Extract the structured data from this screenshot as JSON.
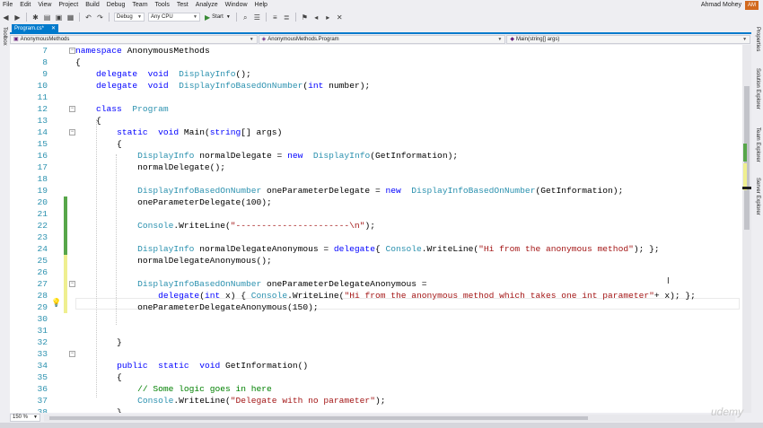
{
  "menu": [
    "File",
    "Edit",
    "View",
    "Project",
    "Build",
    "Debug",
    "Team",
    "Tools",
    "Test",
    "Analyze",
    "Window",
    "Help"
  ],
  "user": {
    "name": "Ahmad Mohey",
    "initials": "AM"
  },
  "toolbar": {
    "config": "Debug",
    "platform": "Any CPU",
    "start_label": "Start"
  },
  "side": {
    "left": "Toolbox",
    "right": [
      "Properties",
      "Solution Explorer",
      "Team Explorer",
      "Server Explorer"
    ]
  },
  "tab": {
    "name": "Program.cs*"
  },
  "nav": {
    "project": "AnonymousMethods",
    "class": "AnonymousMethods.Program",
    "member": "Main(string[] args)"
  },
  "zoom": "150 %",
  "code": [
    {
      "n": "7",
      "t": [
        [
          "kw",
          "namespace"
        ],
        [
          "",
          "AnonymousMethods"
        ]
      ]
    },
    {
      "n": "8",
      "t": [
        [
          "",
          "{"
        ]
      ]
    },
    {
      "n": "9",
      "t": [
        [
          "",
          "    "
        ],
        [
          "kw",
          "delegate"
        ],
        [
          "",
          ""
        ],
        [
          "kw",
          "void"
        ],
        [
          "",
          ""
        ],
        [
          "ty",
          "DisplayInfo"
        ],
        [
          "",
          "();"
        ]
      ]
    },
    {
      "n": "10",
      "t": [
        [
          "",
          "    "
        ],
        [
          "kw",
          "delegate"
        ],
        [
          "",
          ""
        ],
        [
          "kw",
          "void"
        ],
        [
          "",
          ""
        ],
        [
          "ty",
          "DisplayInfoBasedOnNumber"
        ],
        [
          "",
          "("
        ],
        [
          "kw",
          "int"
        ],
        [
          "",
          "number);"
        ]
      ]
    },
    {
      "n": "11",
      "t": []
    },
    {
      "n": "12",
      "t": [
        [
          "",
          "    "
        ],
        [
          "kw",
          "class"
        ],
        [
          "",
          ""
        ],
        [
          "ty",
          "Program"
        ]
      ]
    },
    {
      "n": "13",
      "t": [
        [
          "",
          "    {"
        ]
      ]
    },
    {
      "n": "14",
      "t": [
        [
          "",
          "        "
        ],
        [
          "kw",
          "static"
        ],
        [
          "",
          ""
        ],
        [
          "kw",
          "void"
        ],
        [
          "",
          "Main("
        ],
        [
          "kw",
          "string"
        ],
        [
          "",
          "[] args)"
        ]
      ]
    },
    {
      "n": "15",
      "t": [
        [
          "",
          "        {"
        ]
      ]
    },
    {
      "n": "16",
      "t": [
        [
          "",
          "            "
        ],
        [
          "ty",
          "DisplayInfo"
        ],
        [
          "",
          "normalDelegate = "
        ],
        [
          "kw",
          "new"
        ],
        [
          "",
          ""
        ],
        [
          "ty",
          "DisplayInfo"
        ],
        [
          "",
          "(GetInformation);"
        ]
      ]
    },
    {
      "n": "17",
      "t": [
        [
          "",
          "            normalDelegate();"
        ]
      ]
    },
    {
      "n": "18",
      "t": []
    },
    {
      "n": "19",
      "t": [
        [
          "",
          "            "
        ],
        [
          "ty",
          "DisplayInfoBasedOnNumber"
        ],
        [
          "",
          "oneParameterDelegate = "
        ],
        [
          "kw",
          "new"
        ],
        [
          "",
          ""
        ],
        [
          "ty",
          "DisplayInfoBasedOnNumber"
        ],
        [
          "",
          "(GetInformation);"
        ]
      ]
    },
    {
      "n": "20",
      "t": [
        [
          "",
          "            oneParameterDelegate(100);"
        ]
      ]
    },
    {
      "n": "21",
      "t": []
    },
    {
      "n": "22",
      "t": [
        [
          "",
          "            "
        ],
        [
          "ty",
          "Console"
        ],
        [
          "",
          ".WriteLine("
        ],
        [
          "st",
          "\"----------------------\\n\""
        ],
        [
          "",
          ");"
        ]
      ]
    },
    {
      "n": "23",
      "t": []
    },
    {
      "n": "24",
      "t": [
        [
          "",
          "            "
        ],
        [
          "ty",
          "DisplayInfo"
        ],
        [
          "",
          "normalDelegateAnonymous = "
        ],
        [
          "kw",
          "delegate"
        ],
        [
          "",
          "{ "
        ],
        [
          "ty",
          "Console"
        ],
        [
          "",
          ".WriteLine("
        ],
        [
          "st",
          "\"Hi from the anonymous method\""
        ],
        [
          "",
          "); };"
        ]
      ]
    },
    {
      "n": "25",
      "t": [
        [
          "",
          "            normalDelegateAnonymous();"
        ]
      ]
    },
    {
      "n": "26",
      "t": []
    },
    {
      "n": "27",
      "t": [
        [
          "",
          "            "
        ],
        [
          "ty",
          "DisplayInfoBasedOnNumber"
        ],
        [
          "",
          "oneParameterDelegateAnonymous ="
        ]
      ]
    },
    {
      "n": "28",
      "t": [
        [
          "",
          "                "
        ],
        [
          "kw",
          "delegate"
        ],
        [
          "",
          "("
        ],
        [
          "kw",
          "int"
        ],
        [
          "",
          "x) { "
        ],
        [
          "ty",
          "Console"
        ],
        [
          "",
          ".WriteLine("
        ],
        [
          "st",
          "\"Hi from the anonymous method which takes one int parameter\""
        ],
        [
          "",
          "+ x); };"
        ]
      ]
    },
    {
      "n": "29",
      "t": [
        [
          "",
          "            oneParameterDelegateAnonymous(150);"
        ]
      ]
    },
    {
      "n": "30",
      "t": []
    },
    {
      "n": "31",
      "t": []
    },
    {
      "n": "32",
      "t": [
        [
          "",
          "        }"
        ]
      ]
    },
    {
      "n": "33",
      "t": []
    },
    {
      "n": "34",
      "t": [
        [
          "",
          "        "
        ],
        [
          "kw",
          "public"
        ],
        [
          "",
          ""
        ],
        [
          "kw",
          "static"
        ],
        [
          "",
          ""
        ],
        [
          "kw",
          "void"
        ],
        [
          "",
          "GetInformation()"
        ]
      ]
    },
    {
      "n": "35",
      "t": [
        [
          "",
          "        {"
        ]
      ]
    },
    {
      "n": "36",
      "t": [
        [
          "",
          "            "
        ],
        [
          "cm",
          "// Some logic goes in here"
        ]
      ]
    },
    {
      "n": "37",
      "t": [
        [
          "",
          "            "
        ],
        [
          "ty",
          "Console"
        ],
        [
          "",
          ".WriteLine("
        ],
        [
          "st",
          "\"Delegate with no parameter\""
        ],
        [
          "",
          ");"
        ]
      ]
    },
    {
      "n": "38",
      "t": [
        [
          "",
          "        }"
        ]
      ]
    },
    {
      "n": "39",
      "t": []
    }
  ]
}
